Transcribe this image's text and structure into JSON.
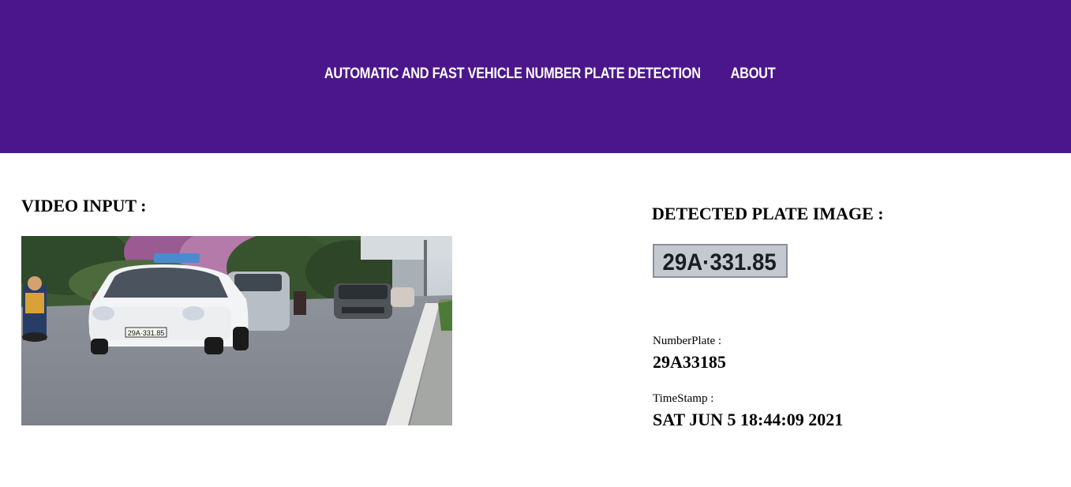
{
  "header": {
    "nav_items": [
      {
        "label": "AUTOMATIC AND FAST VEHICLE NUMBER PLATE DETECTION"
      },
      {
        "label": "ABOUT"
      }
    ],
    "background_color": "#4b168b"
  },
  "video_section": {
    "heading": "VIDEO INPUT :",
    "frame_taxi_plate": "29A·331.85"
  },
  "plate_section": {
    "heading": "DETECTED PLATE IMAGE :",
    "plate_image_text": "29A·331.85",
    "number_plate_label": "NumberPlate :",
    "number_plate_value": "29A33185",
    "timestamp_label": "TimeStamp :",
    "timestamp_value": "SAT JUN 5 18:44:09 2021"
  }
}
